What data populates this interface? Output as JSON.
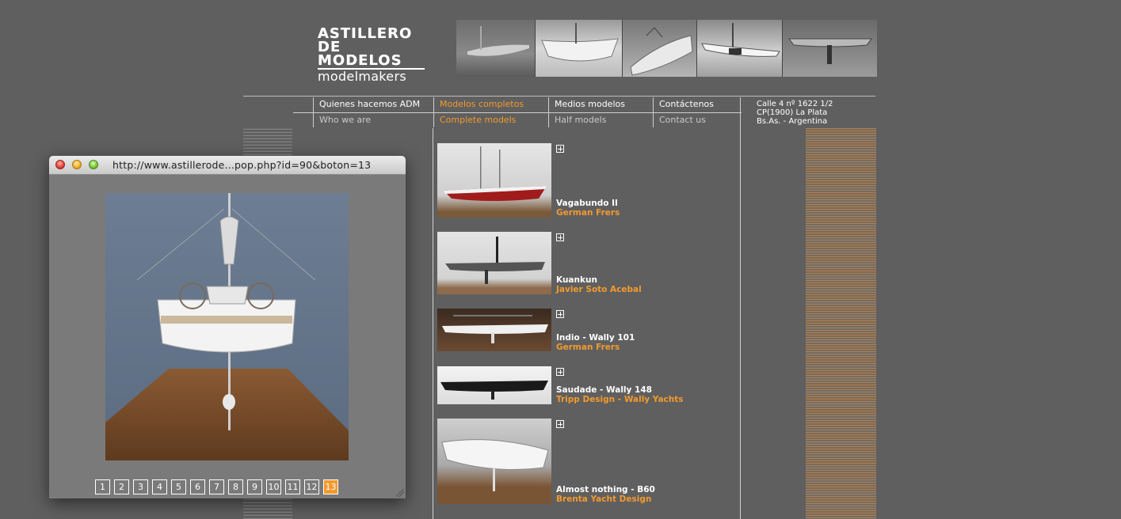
{
  "logo": {
    "line1": "ASTILLERO",
    "line2": "DE MODELOS",
    "line3": "modelmakers"
  },
  "nav": [
    {
      "es": "Quienes hacemos ADM",
      "en": "Who we are",
      "active": false
    },
    {
      "es": "Modelos completos",
      "en": "Complete models",
      "active": true
    },
    {
      "es": "Medios modelos",
      "en": "Half models",
      "active": false
    },
    {
      "es": "Contáctenos",
      "en": "Contact us",
      "active": false
    }
  ],
  "address": {
    "line1": "Calle 4 nº 1622 1/2",
    "line2": "CP(1900) La Plata",
    "line3": "Bs.As. - Argentina"
  },
  "models": [
    {
      "name": "Vagabundo II",
      "designer": "German Frers"
    },
    {
      "name": "Kuankun",
      "designer": "Javier Soto Acebal"
    },
    {
      "name": "Indio - Wally 101",
      "designer": "German Frers"
    },
    {
      "name": "Saudade - Wally 148",
      "designer": "Tripp Design - Wally Yachts"
    },
    {
      "name": "Almost nothing - B60",
      "designer": "Brenta Yacht Design"
    }
  ],
  "popup": {
    "title": "http://www.astillerode...pop.php?id=90&boton=13",
    "pages": [
      "1",
      "2",
      "3",
      "4",
      "5",
      "6",
      "7",
      "8",
      "9",
      "10",
      "11",
      "12",
      "13"
    ],
    "active_page": "13"
  },
  "colors": {
    "accent": "#f29a2e",
    "background": "#5f5f5f"
  }
}
